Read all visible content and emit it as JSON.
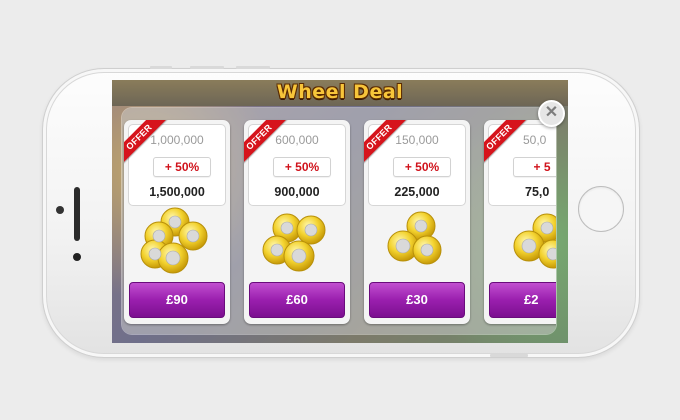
{
  "game": {
    "title": "Wheel Deal"
  },
  "offer_badge": "OFFER",
  "offers": [
    {
      "original": "1,000,000",
      "bonus": "+ 50%",
      "total": "1,500,000",
      "price": "£90"
    },
    {
      "original": "600,000",
      "bonus": "+ 50%",
      "total": "900,000",
      "price": "£60"
    },
    {
      "original": "150,000",
      "bonus": "+ 50%",
      "total": "225,000",
      "price": "£30"
    },
    {
      "original": "50,0",
      "bonus": "+ 5",
      "total": "75,0",
      "price": "£2"
    }
  ],
  "colors": {
    "accent_purple": "#9a1fae",
    "offer_red": "#d6141c",
    "bonus_red": "#d0121b",
    "coin_gold": "#f3d22e"
  },
  "icons": {
    "close": "close-icon",
    "coins": "gold-coins-icon"
  }
}
